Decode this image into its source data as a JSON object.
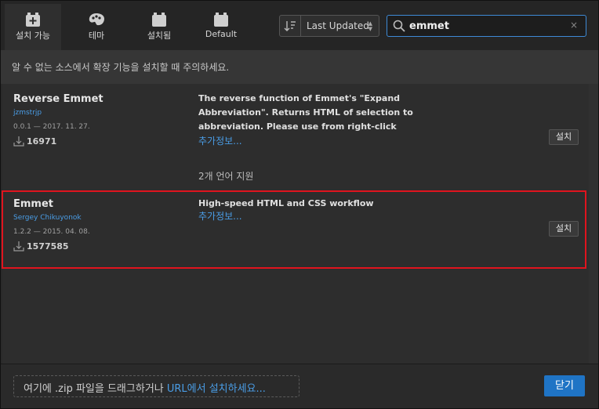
{
  "tabs": [
    {
      "label": "설치 가능",
      "icon": "plus-box-icon",
      "active": true
    },
    {
      "label": "테마",
      "icon": "palette-icon",
      "active": false
    },
    {
      "label": "설치됨",
      "icon": "box-icon",
      "active": false
    },
    {
      "label": "Default",
      "icon": "box-icon",
      "active": false
    }
  ],
  "sort": {
    "icon": "sort-icon",
    "label": "Last Updated"
  },
  "search": {
    "value": "emmet",
    "icon": "search-icon",
    "clear": "×"
  },
  "warning": "알 수 없는 소스에서 확장 기능을 설치할 때 주의하세요.",
  "extensions": [
    {
      "name": "Reverse Emmet",
      "author": "jzmstrjp",
      "version": "0.0.1 — 2017. 11. 27.",
      "downloads": "16971",
      "description": "The reverse function of Emmet's \"Expand Abbreviation\". Returns HTML of selection to abbreviation. Please use from right-click",
      "more": "추가정보...",
      "languages": "2개 언어 지원",
      "install": "설치"
    },
    {
      "name": "Emmet",
      "author": "Sergey Chikuyonok",
      "version": "1.2.2 — 2015. 04. 08.",
      "downloads": "1577585",
      "description": "High-speed HTML and CSS workflow",
      "more": "추가정보...",
      "install": "설치"
    }
  ],
  "footer": {
    "drop_prefix": "여기에 .zip 파일을 드래그하거나 ",
    "drop_link": "URL에서 설치하세요...",
    "close": "닫기"
  },
  "colors": {
    "accent": "#1f74c5",
    "link": "#4a9de6",
    "highlight": "#e0141e"
  }
}
